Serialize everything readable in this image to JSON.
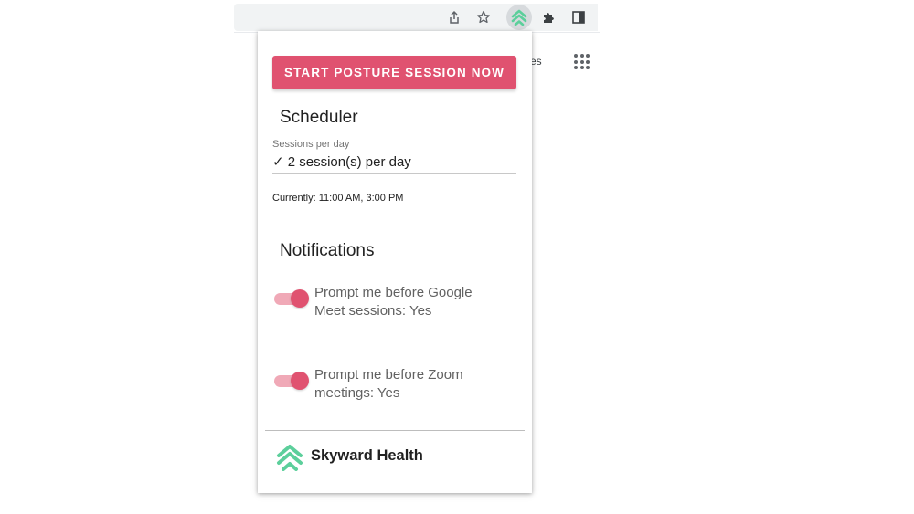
{
  "browser": {
    "background_link_partial": "es",
    "icons": [
      "share-icon",
      "star-icon",
      "skyward-extension-icon",
      "puzzle-icon",
      "side-panel-icon",
      "apps-grid-icon"
    ]
  },
  "popup": {
    "start_button_label": "START POSTURE SESSION NOW",
    "scheduler": {
      "title": "Scheduler",
      "sessions_label": "Sessions per day",
      "sessions_value": "✓ 2 session(s) per day",
      "currently": "Currently: 11:00 AM, 3:00 PM"
    },
    "notifications": {
      "title": "Notifications",
      "google_meet": {
        "label": "Prompt me before Google Meet sessions: Yes",
        "enabled": true
      },
      "zoom": {
        "label": "Prompt me before Zoom meetings: Yes",
        "enabled": true
      }
    },
    "footer": {
      "brand_name": "Skyward Health"
    }
  },
  "colors": {
    "accent": "#e05270",
    "accent_light": "#f0a9b7",
    "brand_green": "#5ccf9b"
  }
}
